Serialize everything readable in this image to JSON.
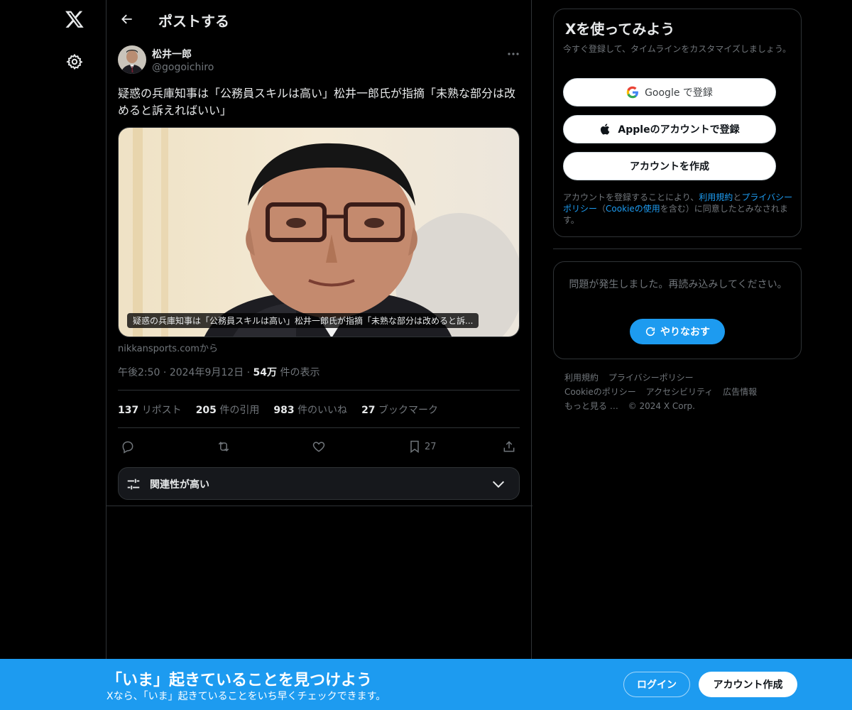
{
  "header": {
    "title": "ポストする"
  },
  "post": {
    "author_name": "松井一郎",
    "author_handle": "@gogoichiro",
    "text": "疑惑の兵庫知事は「公務員スキルは高い」松井一郎氏が指摘「未熟な部分は改めると訴えればいい」",
    "media_caption": "疑惑の兵庫知事は「公務員スキルは高い」松井一郎氏が指摘「未熟な部分は改めると訴...",
    "source": "nikkansports.comから",
    "time": "午後2:50",
    "date": "2024年9月12日",
    "views_count": "54万",
    "views_label": "件の表示",
    "stats": {
      "reposts_count": "137",
      "reposts_label": "リポスト",
      "quotes_count": "205",
      "quotes_label": "件の引用",
      "likes_count": "983",
      "likes_label": "件のいいね",
      "bookmarks_count": "27",
      "bookmarks_label": "ブックマーク"
    },
    "bookmark_action_count": "27",
    "relevance_label": "関連性が高い"
  },
  "sidebar": {
    "signup_title": "Xを使ってみよう",
    "signup_sub": "今すぐ登録して、タイムラインをカスタマイズしましょう。",
    "google_label": "Google で登録",
    "apple_label": "Appleのアカウントで登録",
    "create_account_label": "アカウントを作成",
    "legal_prefix": "アカウントを登録することにより、",
    "legal_terms": "利用規約",
    "legal_and": "と",
    "legal_privacy": "プライバシーポリシー",
    "legal_paren_open": "（",
    "legal_cookie": "Cookieの使用",
    "legal_suffix": "を含む）に同意したとみなされます。",
    "error_text": "問題が発生しました。再読み込みしてください。",
    "retry_label": "やりなおす",
    "footer": {
      "terms": "利用規約",
      "privacy": "プライバシーポリシー",
      "cookie": "Cookieのポリシー",
      "accessibility": "アクセシビリティ",
      "ads": "広告情報",
      "more": "もっと見る …",
      "copyright": "© 2024 X Corp."
    }
  },
  "bottom_bar": {
    "title": "「いま」起きていることを見つけよう",
    "subtitle": "Xなら、「いま」起きていることをいち早くチェックできます。",
    "login_label": "ログイン",
    "create_label": "アカウント作成"
  },
  "colors": {
    "accent": "#1d9bf0",
    "background": "#000000",
    "border": "#2f3336",
    "muted": "#71767b"
  }
}
